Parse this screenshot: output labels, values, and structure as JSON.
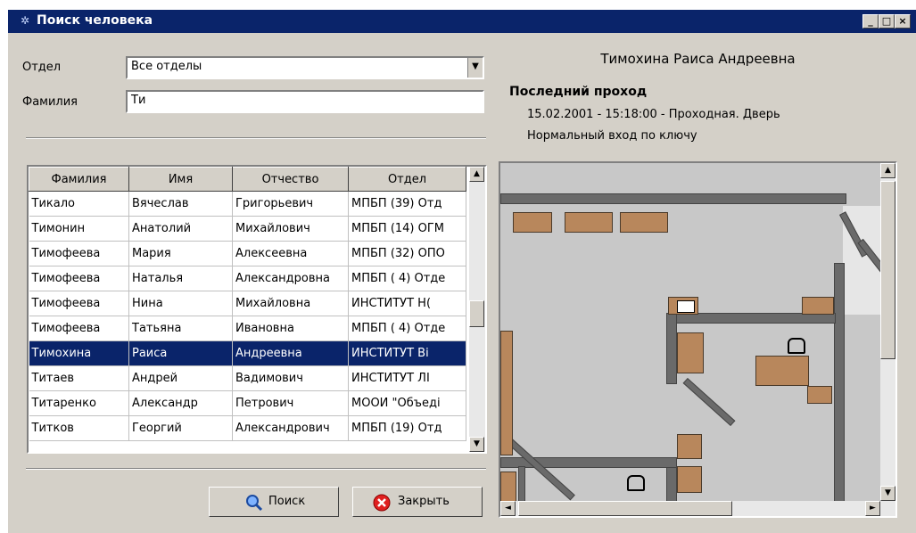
{
  "window": {
    "title": "Поиск человека",
    "minimize": "_",
    "maximize": "□",
    "close": "×"
  },
  "filters": {
    "department_label": "Отдел",
    "department_value": "Все отделы",
    "surname_label": "Фамилия",
    "surname_value": "Ти"
  },
  "table": {
    "columns": [
      "Фамилия",
      "Имя",
      "Отчество",
      "Отдел"
    ],
    "rows": [
      [
        "Тикало",
        "Вячеслав",
        "Григорьевич",
        "МПБП (39) Отд"
      ],
      [
        "Тимонин",
        "Анатолий",
        "Михайлович",
        "МПБП (14) ОГМ"
      ],
      [
        "Тимофеева",
        "Мария",
        "Алексеевна",
        "МПБП (32) ОПО"
      ],
      [
        "Тимофеева",
        "Наталья",
        "Александровна",
        "МПБП ( 4) Отде"
      ],
      [
        "Тимофеева",
        "Нина",
        "Михайловна",
        "ИНСТИТУТ Н("
      ],
      [
        "Тимофеева",
        "Татьяна",
        "Ивановна",
        "МПБП ( 4) Отде"
      ],
      [
        "Тимохина",
        "Раиса",
        "Андреевна",
        "ИНСТИТУТ Ві"
      ],
      [
        "Титаев",
        "Андрей",
        "Вадимович",
        "ИНСТИТУТ ЛІ"
      ],
      [
        "Титаренко",
        "Александр",
        "Петрович",
        "МООИ \"Объеді"
      ],
      [
        "Титков",
        "Георгий",
        "Александрович",
        "МПБП (19) Отд"
      ]
    ],
    "selected_index": 6
  },
  "buttons": {
    "search": "Поиск",
    "close": "Закрыть"
  },
  "person": {
    "name": "Тимохина Раиса Андреевна",
    "last_pass_label": "Последний проход",
    "last_pass_detail": "15.02.2001 - 15:18:00 - Проходная. Дверь",
    "last_pass_event": "Нормальный вход по ключу"
  },
  "colors": {
    "titlebar": "#0a246a",
    "selection": "#0a246a",
    "desk": "#b8875c",
    "wall": "#6a6a6a"
  }
}
